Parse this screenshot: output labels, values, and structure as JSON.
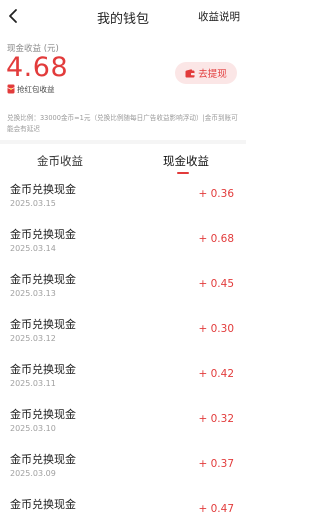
{
  "header": {
    "title": "我的钱包",
    "help_label": "收益说明",
    "back_icon": "chevron-left-icon"
  },
  "balance": {
    "label": "现金收益 (元)",
    "value": "4.68",
    "tag_label": "抢红包收益",
    "withdraw_label": "去提现"
  },
  "note": "兑换比例：33000金币≈1元（兑换比例随每日广告收益影响浮动）|金币到账可能会有延迟",
  "tabs": [
    {
      "label": "金币收益",
      "active": false
    },
    {
      "label": "现金收益",
      "active": true
    }
  ],
  "records": [
    {
      "title": "金币兑换现金",
      "date": "2025.03.15",
      "amount": "+ 0.36"
    },
    {
      "title": "金币兑换现金",
      "date": "2025.03.14",
      "amount": "+ 0.68"
    },
    {
      "title": "金币兑换现金",
      "date": "2025.03.13",
      "amount": "+ 0.45"
    },
    {
      "title": "金币兑换现金",
      "date": "2025.03.12",
      "amount": "+ 0.30"
    },
    {
      "title": "金币兑换现金",
      "date": "2025.03.11",
      "amount": "+ 0.42"
    },
    {
      "title": "金币兑换现金",
      "date": "2025.03.10",
      "amount": "+ 0.32"
    },
    {
      "title": "金币兑换现金",
      "date": "2025.03.09",
      "amount": "+ 0.37"
    },
    {
      "title": "金币兑换现金",
      "date": "",
      "amount": "+ 0.47"
    }
  ],
  "colors": {
    "accent": "#e23b3b",
    "withdraw_bg": "#fbe6e6",
    "muted_text": "#a0a0a0"
  }
}
